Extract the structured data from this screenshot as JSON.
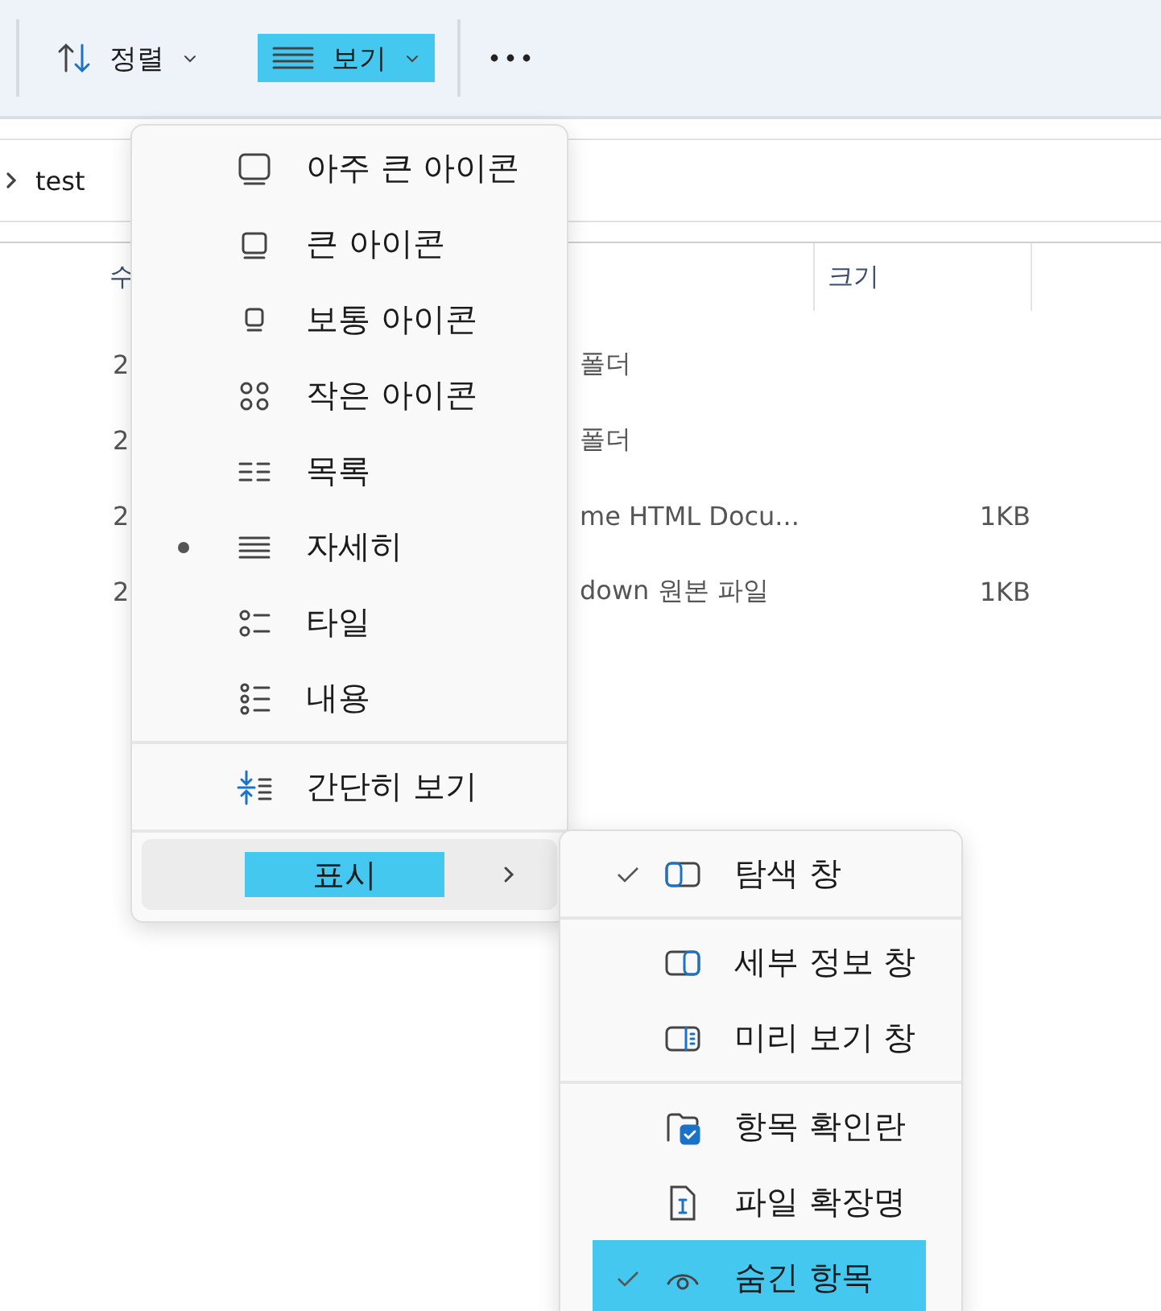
{
  "toolbar": {
    "buttons": [
      {
        "kind": "sort",
        "label": "정렬",
        "highlighted": false
      },
      {
        "kind": "view",
        "label": "보기",
        "highlighted": true
      }
    ]
  },
  "breadcrumb": {
    "items": [
      "test"
    ]
  },
  "table": {
    "columns": [
      {
        "label": "수"
      },
      {
        "label": "크기"
      }
    ],
    "rows": [
      {
        "column_1": "2",
        "type": "폴더"
      },
      {
        "column_1": "2",
        "type": "폴더"
      },
      {
        "column_1": "2",
        "type": "me HTML Docu...",
        "size": "1KB"
      },
      {
        "column_1": "2",
        "type": "down 원본 파일",
        "size": "1KB"
      }
    ]
  },
  "view_menu": {
    "sections": [
      [
        {
          "kind": "xl",
          "label": "아주 큰 아이콘",
          "selected": false
        },
        {
          "kind": "lg",
          "label": "큰 아이콘",
          "selected": false
        },
        {
          "kind": "md",
          "label": "보통 아이콘",
          "selected": false
        },
        {
          "kind": "sm",
          "label": "작은 아이콘",
          "selected": false
        },
        {
          "kind": "list",
          "label": "목록",
          "selected": false
        },
        {
          "kind": "details",
          "label": "자세히",
          "selected": true
        },
        {
          "kind": "tiles",
          "label": "타일",
          "selected": false
        },
        {
          "kind": "content",
          "label": "내용",
          "selected": false
        }
      ],
      [
        {
          "kind": "compact",
          "label": "간단히 보기",
          "selected": false
        }
      ]
    ],
    "show": {
      "label": "표시",
      "highlighted": true,
      "expanded": true
    }
  },
  "show_menu": {
    "sections": [
      [
        {
          "kind": "nav",
          "label": "탐색 창",
          "checked": true,
          "highlighted": false
        }
      ],
      [
        {
          "kind": "detailspane",
          "label": "세부 정보 창",
          "checked": false,
          "highlighted": false
        },
        {
          "kind": "preview",
          "label": "미리 보기 창",
          "checked": false,
          "highlighted": false
        }
      ],
      [
        {
          "kind": "checkbox",
          "label": "항목 확인란",
          "checked": false,
          "highlighted": false
        },
        {
          "kind": "ext",
          "label": "파일 확장명",
          "checked": false,
          "highlighted": false
        },
        {
          "kind": "hidden",
          "label": "숨긴 항목",
          "checked": true,
          "highlighted": true
        }
      ]
    ]
  }
}
